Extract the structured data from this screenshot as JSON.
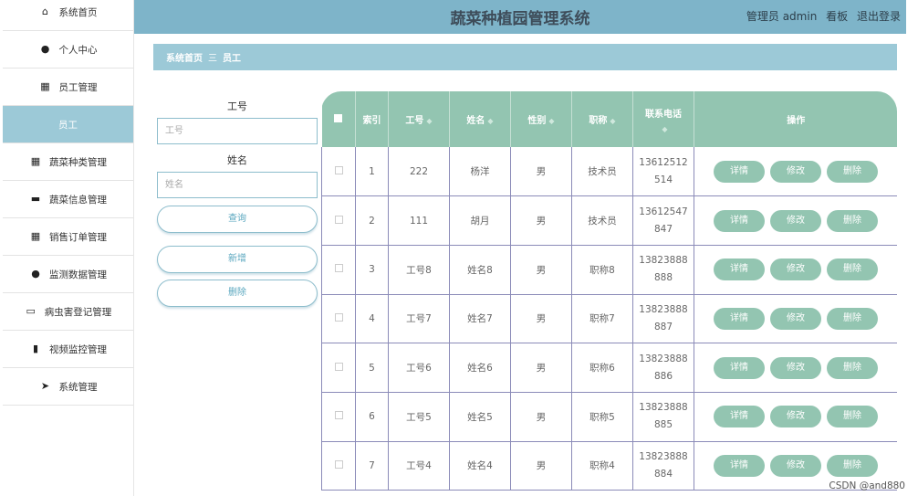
{
  "sidebar": {
    "items": [
      {
        "icon": "home-icon",
        "glyph": "⌂",
        "label": "系统首页"
      },
      {
        "icon": "user-icon",
        "glyph": "●",
        "label": "个人中心"
      },
      {
        "icon": "grid-icon",
        "glyph": "▦",
        "label": "员工管理"
      },
      {
        "icon": "",
        "glyph": "",
        "label": "员工",
        "active": true
      },
      {
        "icon": "grid-icon",
        "glyph": "▦",
        "label": "蔬菜种类管理"
      },
      {
        "icon": "briefcase-icon",
        "glyph": "▬",
        "label": "蔬菜信息管理"
      },
      {
        "icon": "grid-icon",
        "glyph": "▦",
        "label": "销售订单管理"
      },
      {
        "icon": "user-icon",
        "glyph": "●",
        "label": "监测数据管理"
      },
      {
        "icon": "monitor-icon",
        "glyph": "▭",
        "label": "病虫害登记管理"
      },
      {
        "icon": "film-icon",
        "glyph": "▮",
        "label": "视频监控管理"
      },
      {
        "icon": "send-icon",
        "glyph": "➤",
        "label": "系统管理"
      }
    ]
  },
  "header": {
    "title": "蔬菜种植园管理系统",
    "user": "管理员 admin",
    "dashboard": "看板",
    "logout": "退出登录"
  },
  "breadcrumb": {
    "home": "系统首页",
    "separator": "三",
    "current": "员工"
  },
  "search": {
    "employee_id_label": "工号",
    "employee_id_placeholder": "工号",
    "name_label": "姓名",
    "name_placeholder": "姓名",
    "query_button": "查询",
    "add_button": "新增",
    "delete_button": "删除"
  },
  "table": {
    "columns": [
      "索引",
      "工号",
      "姓名",
      "性别",
      "职称",
      "联系电话",
      "操作"
    ],
    "actions": {
      "detail": "详情",
      "edit": "修改",
      "delete": "删除"
    },
    "rows": [
      {
        "index": "1",
        "id": "222",
        "name": "杨洋",
        "gender": "男",
        "title": "技术员",
        "phone_a": "13612512",
        "phone_b": "514"
      },
      {
        "index": "2",
        "id": "111",
        "name": "胡月",
        "gender": "男",
        "title": "技术员",
        "phone_a": "13612547",
        "phone_b": "847"
      },
      {
        "index": "3",
        "id": "工号8",
        "name": "姓名8",
        "gender": "男",
        "title": "职称8",
        "phone_a": "13823888",
        "phone_b": "888"
      },
      {
        "index": "4",
        "id": "工号7",
        "name": "姓名7",
        "gender": "男",
        "title": "职称7",
        "phone_a": "13823888",
        "phone_b": "887"
      },
      {
        "index": "5",
        "id": "工号6",
        "name": "姓名6",
        "gender": "男",
        "title": "职称6",
        "phone_a": "13823888",
        "phone_b": "886"
      },
      {
        "index": "6",
        "id": "工号5",
        "name": "姓名5",
        "gender": "男",
        "title": "职称5",
        "phone_a": "13823888",
        "phone_b": "885"
      },
      {
        "index": "7",
        "id": "工号4",
        "name": "姓名4",
        "gender": "男",
        "title": "职称4",
        "phone_a": "13823888",
        "phone_b": "884"
      }
    ]
  },
  "watermark": "CSDN @and880",
  "colors": {
    "accent": "#93c5b1",
    "header_bg": "#7eb4c9",
    "breadcrumb_bg": "#9cc9d7"
  }
}
